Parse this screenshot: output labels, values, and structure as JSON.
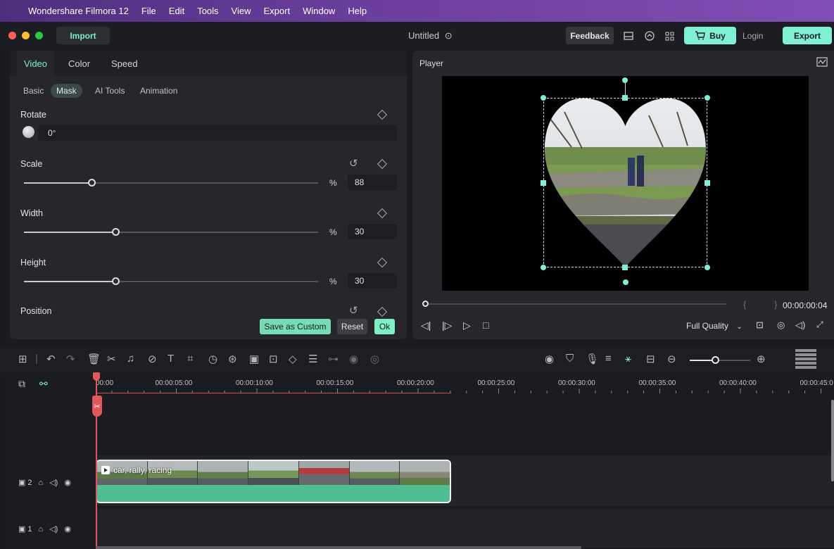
{
  "menubar": {
    "app_name": "Wondershare Filmora 12",
    "items": [
      "File",
      "Edit",
      "Tools",
      "View",
      "Export",
      "Window",
      "Help"
    ]
  },
  "toolbar": {
    "import_label": "Import",
    "project_title": "Untitled",
    "feedback_label": "Feedback",
    "buy_label": "Buy",
    "login_label": "Login",
    "export_label": "Export"
  },
  "panel": {
    "tabs": [
      "Video",
      "Color",
      "Speed"
    ],
    "active_tab": "Video",
    "subtabs": [
      "Basic",
      "Mask",
      "AI Tools",
      "Animation"
    ],
    "active_subtab": "Mask",
    "rotate": {
      "label": "Rotate",
      "value": "0°"
    },
    "scale": {
      "label": "Scale",
      "unit": "%",
      "value": "88",
      "slider_fraction": 0.23
    },
    "width": {
      "label": "Width",
      "unit": "%",
      "value": "30",
      "slider_fraction": 0.31
    },
    "height": {
      "label": "Height",
      "unit": "%",
      "value": "30",
      "slider_fraction": 0.31
    },
    "position": {
      "label": "Position"
    },
    "save_custom_label": "Save as Custom",
    "reset_label": "Reset",
    "ok_label": "Ok"
  },
  "player": {
    "label": "Player",
    "timecode": "00:00:00:04",
    "braces": "{ }",
    "quality": "Full Quality",
    "mask_shape": "heart"
  },
  "timeline": {
    "ruler_labels": [
      "00:00",
      "00:00:05:00",
      "00:00:10:00",
      "00:00:15:00",
      "00:00:20:00",
      "00:00:25:00",
      "00:00:30:00",
      "00:00:35:00",
      "00:00:40:00",
      "00:00:45:0"
    ],
    "zoom_fraction": 0.42,
    "clip_title": "car, rally, racing",
    "track2_label": "2",
    "track1_label": "1"
  },
  "colors": {
    "accent": "#7ff0c5",
    "playhead": "#e0585a",
    "clip": "#4fbf92"
  }
}
